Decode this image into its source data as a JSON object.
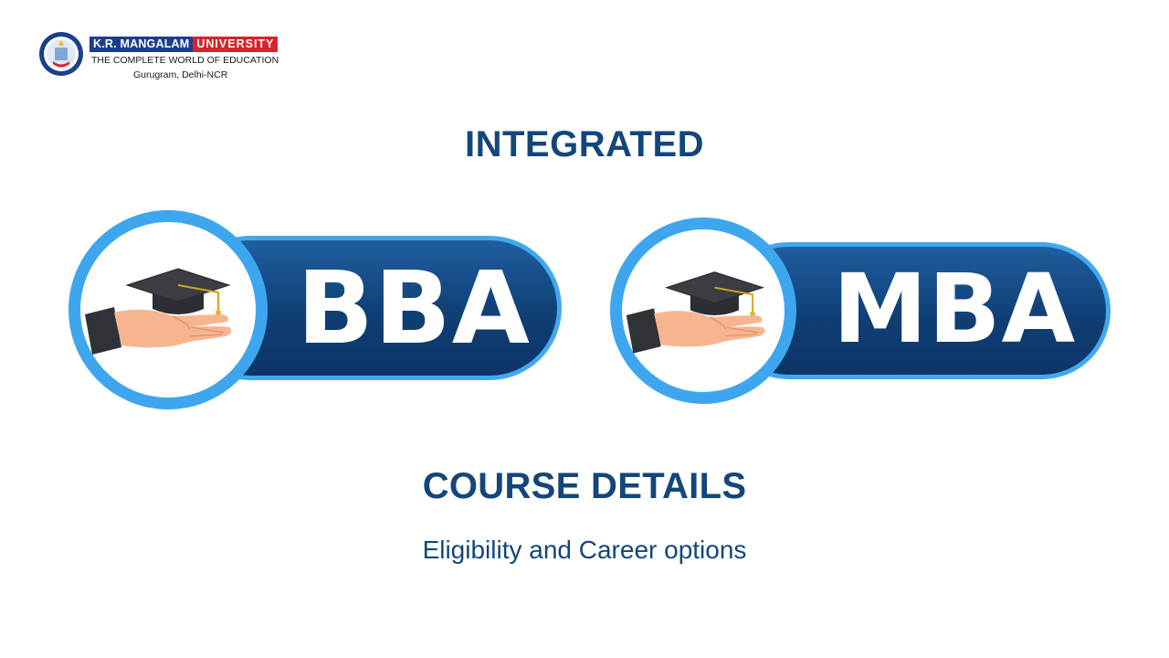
{
  "logo": {
    "name_part1": "K.R. MANGALAM",
    "name_part2": "UNIVERSITY",
    "tagline": "THE COMPLETE WORLD OF EDUCATION",
    "location": "Gurugram, Delhi-NCR"
  },
  "heading": "INTEGRATED",
  "badges": [
    {
      "label": "BBA",
      "icon": "graduation-cap-hand-icon"
    },
    {
      "label": "MBA",
      "icon": "graduation-cap-hand-icon"
    }
  ],
  "course_heading": "COURSE DETAILS",
  "subtitle": "Eligibility and Career options",
  "colors": {
    "heading": "#13467a",
    "pill_fill": "#13467a",
    "pill_border": "#41a8ef",
    "logo_blue": "#1c3f8c",
    "logo_red": "#d8232a"
  }
}
